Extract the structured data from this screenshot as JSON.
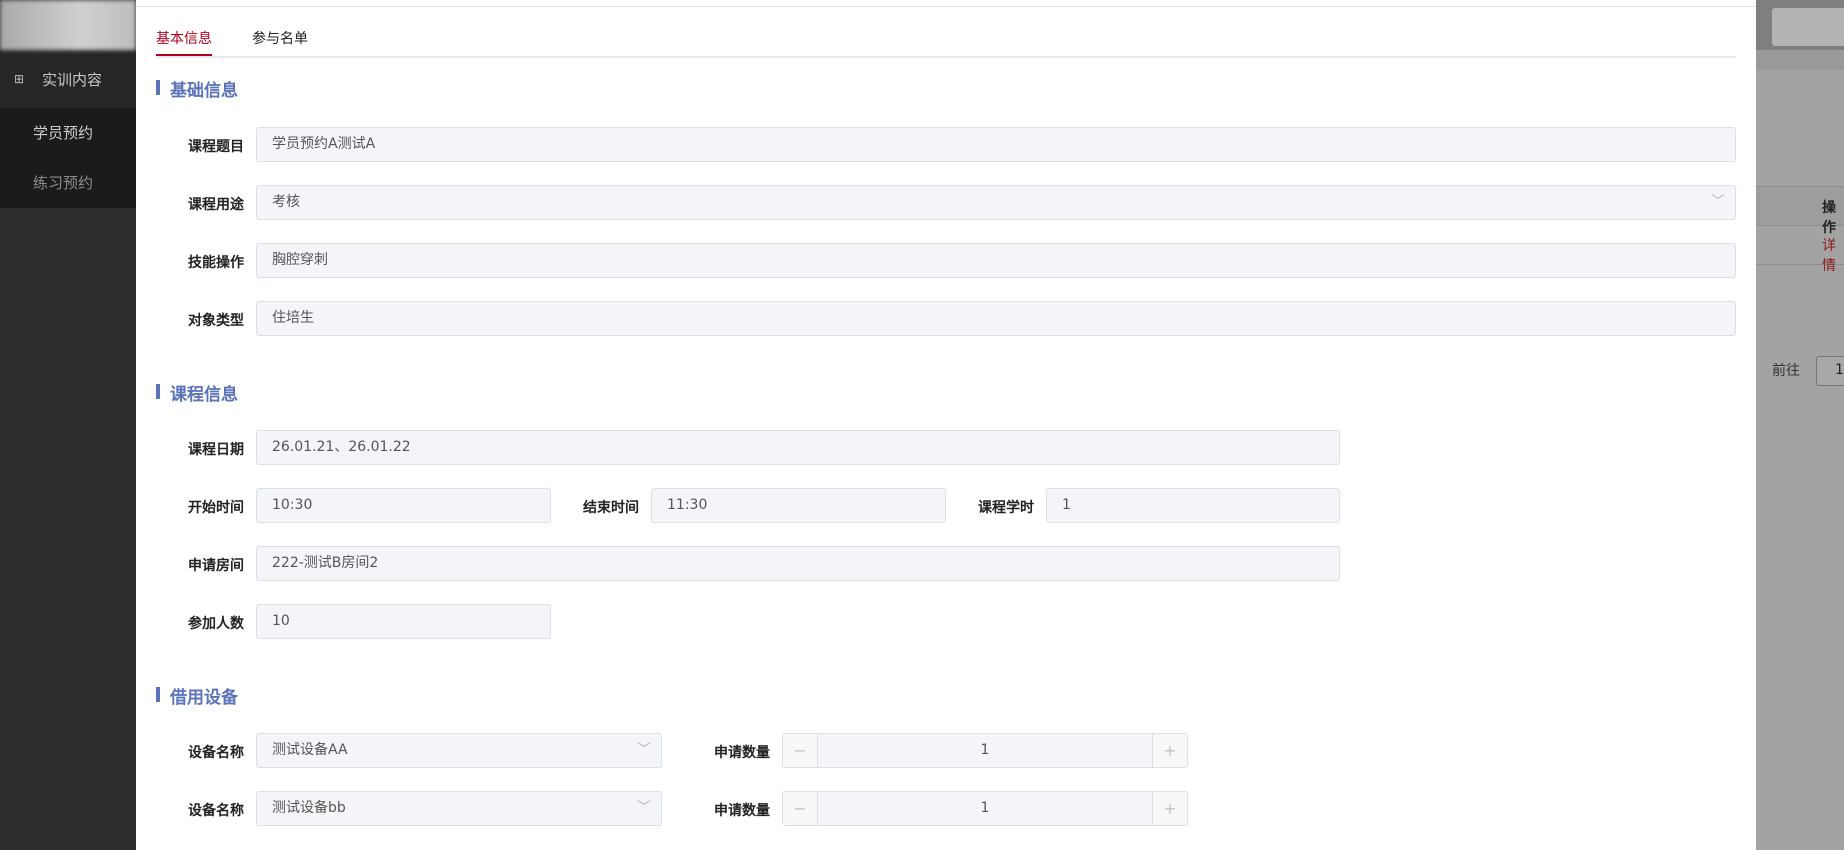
{
  "sidebar": {
    "group_label": "实训内容",
    "items": [
      {
        "label": "学员预约"
      },
      {
        "label": "练习预约"
      }
    ]
  },
  "background_page": {
    "column_header": "操作",
    "row_action": "详情",
    "pager_goto": "前往",
    "pager_page": "1"
  },
  "tabs": [
    {
      "label": "基本信息",
      "active": true
    },
    {
      "label": "参与名单",
      "active": false
    }
  ],
  "sections": {
    "basic": "基础信息",
    "course": "课程信息",
    "equipment": "借用设备"
  },
  "basic": {
    "title_label": "课程题目",
    "title_value": "学员预约A测试A",
    "purpose_label": "课程用途",
    "purpose_value": "考核",
    "skill_label": "技能操作",
    "skill_value": "胸腔穿刺",
    "target_label": "对象类型",
    "target_value": "住培生"
  },
  "course": {
    "date_label": "课程日期",
    "date_value": "26.01.21、26.01.22",
    "start_label": "开始时间",
    "start_value": "10:30",
    "end_label": "结束时间",
    "end_value": "11:30",
    "hours_label": "课程学时",
    "hours_value": "1",
    "room_label": "申请房间",
    "room_value": "222-测试B房间2",
    "count_label": "参加人数",
    "count_value": "10"
  },
  "equipment": [
    {
      "name_label": "设备名称",
      "name_value": "测试设备AA",
      "qty_label": "申请数量",
      "qty_value": "1"
    },
    {
      "name_label": "设备名称",
      "name_value": "测试设备bb",
      "qty_label": "申请数量",
      "qty_value": "1"
    }
  ],
  "icons": {
    "sidebar_group": "sitemap-icon",
    "select": "chevron-down-icon",
    "minus": "minus-icon",
    "plus": "plus-icon"
  },
  "colors": {
    "accent": "#b0001e",
    "section": "#5b73b8"
  }
}
